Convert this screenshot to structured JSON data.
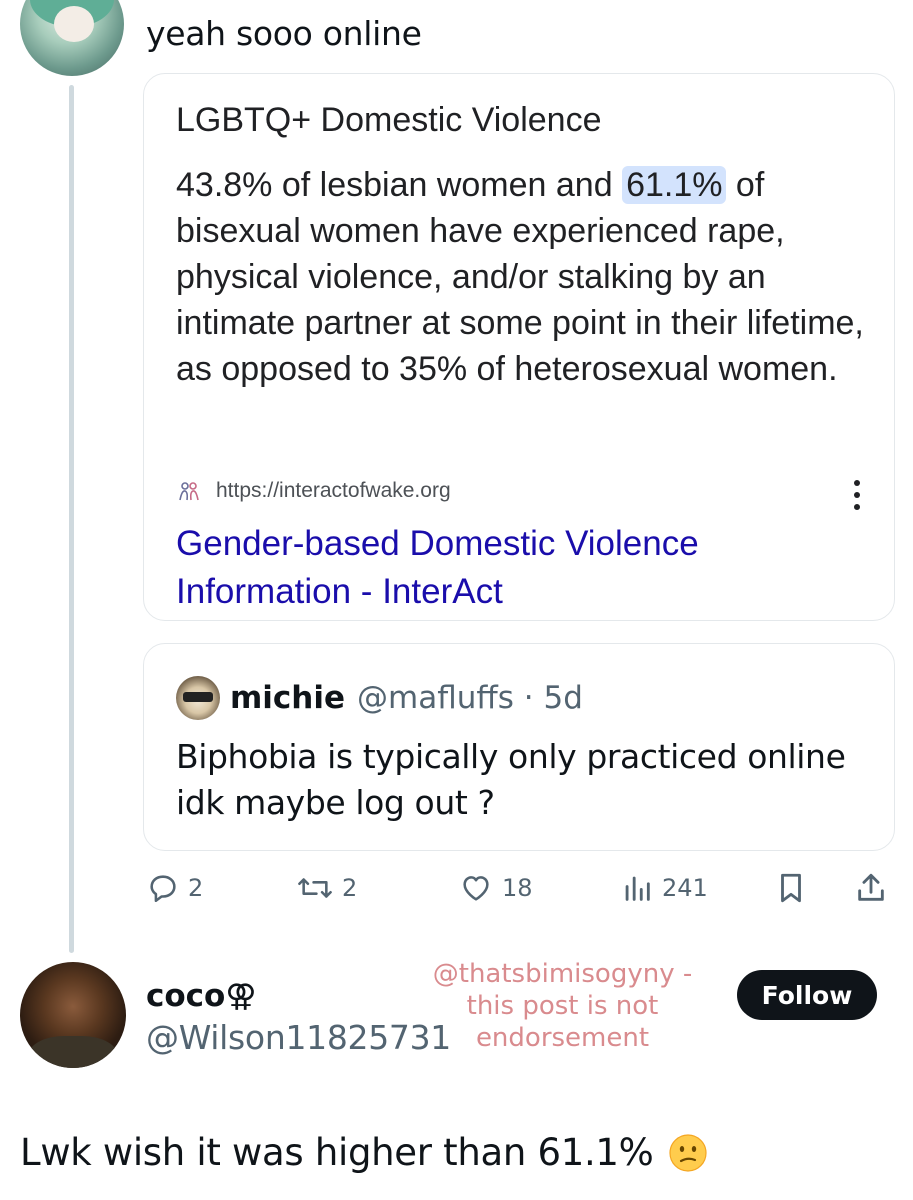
{
  "reply": {
    "text": "yeah sooo online"
  },
  "snippet": {
    "title": "LGBTQ+ Domestic Violence",
    "body_before": "43.8% of lesbian women and ",
    "body_highlight": "61.1%",
    "body_after": " of bisexual women have experienced rape, physical violence, and/or stalking by an intimate partner at some point in their lifetime, as opposed to 35% of heterosexual women.",
    "source_url": "https://interactofwake.org",
    "link_title": "Gender-based Domestic Violence Information - InterAct",
    "highlight_color": "#d3e3fd",
    "link_color": "#1a0dab"
  },
  "quoted_tweet": {
    "name": "michie",
    "handle_time": "@mafluffs · 5d",
    "text": "Biphobia is typically only practiced online idk maybe log out ?"
  },
  "actions": {
    "replies": "2",
    "retweets": "2",
    "likes": "18",
    "views": "241"
  },
  "reply_tweet": {
    "name": "coco",
    "name_symbol": "⚢",
    "handle": "@Wilson11825731",
    "follow_label": "Follow",
    "text": "Lwk wish it was higher than 61.1%",
    "emoji": "confused-face"
  },
  "watermark": {
    "line1": "@thatsbimisogyny -",
    "line2": "this post is not",
    "line3": "endorsement",
    "color": "#d98b8e"
  }
}
